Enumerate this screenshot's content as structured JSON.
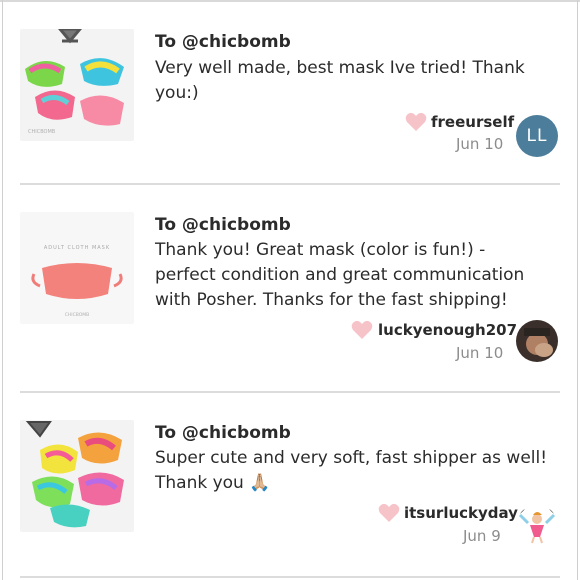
{
  "reviews": [
    {
      "to": "To @chicbomb",
      "text": "Very well made, best mask Ive tried! Thank you:)",
      "user": "freeurself",
      "date": "Jun 10",
      "avatar_initials": "LL",
      "avatar_color": "#4c7d9b",
      "thumb_label": "CHICBOMB"
    },
    {
      "to": "To @chicbomb",
      "text": "Thank you! Great mask (color is fun!) - perfect condition and great communication with Posher. Thanks for the fast shipping!",
      "user": "luckyenough207",
      "date": "Jun 10",
      "thumb_title": "ADULT CLOTH MASK",
      "thumb_label": "CHICBOMB"
    },
    {
      "to": "To @chicbomb",
      "text": "Super cute and very soft, fast shipper as well! Thank you 🙏🏼",
      "user": "itsurluckyday",
      "date": "Jun 9"
    }
  ],
  "colors": {
    "heart": "#f6c3c8",
    "divider": "#dcdcdc",
    "date": "#8c8c8c"
  }
}
